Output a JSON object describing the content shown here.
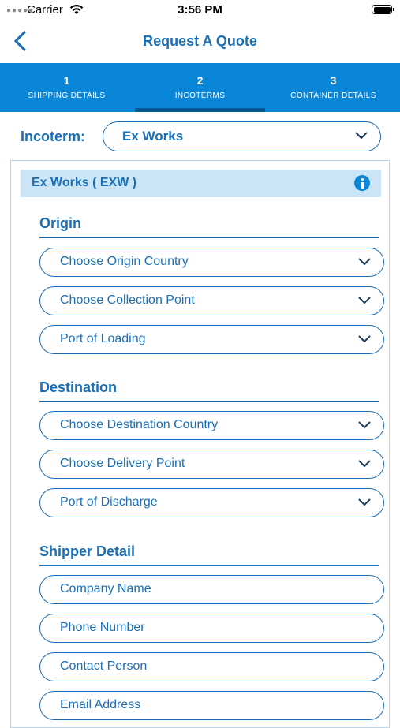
{
  "status_bar": {
    "carrier": "Carrier",
    "time": "3:56 PM"
  },
  "nav": {
    "title": "Request A Quote",
    "back_icon": "chevron-left-icon"
  },
  "steps": [
    {
      "number": "1",
      "label": "SHIPPING DETAILS",
      "active": false
    },
    {
      "number": "2",
      "label": "INCOTERMS",
      "active": true
    },
    {
      "number": "3",
      "label": "CONTAINER DETAILS",
      "active": false
    }
  ],
  "incoterm": {
    "label": "Incoterm:",
    "value": "Ex Works"
  },
  "card": {
    "title": "Ex Works ( EXW )",
    "info_icon": "info-icon"
  },
  "origin": {
    "title": "Origin",
    "fields": [
      "Choose Origin Country",
      "Choose Collection Point",
      "Port of Loading"
    ]
  },
  "destination": {
    "title": "Destination",
    "fields": [
      "Choose Destination Country",
      "Choose Delivery Point",
      "Port of Discharge"
    ]
  },
  "shipper": {
    "title": "Shipper Detail",
    "fields": [
      "Company Name",
      "Phone Number",
      "Contact Person",
      "Email Address"
    ]
  },
  "colors": {
    "primary": "#1a6fb5",
    "stepbar": "#0a86d8",
    "header_bg": "#cce5f6"
  }
}
